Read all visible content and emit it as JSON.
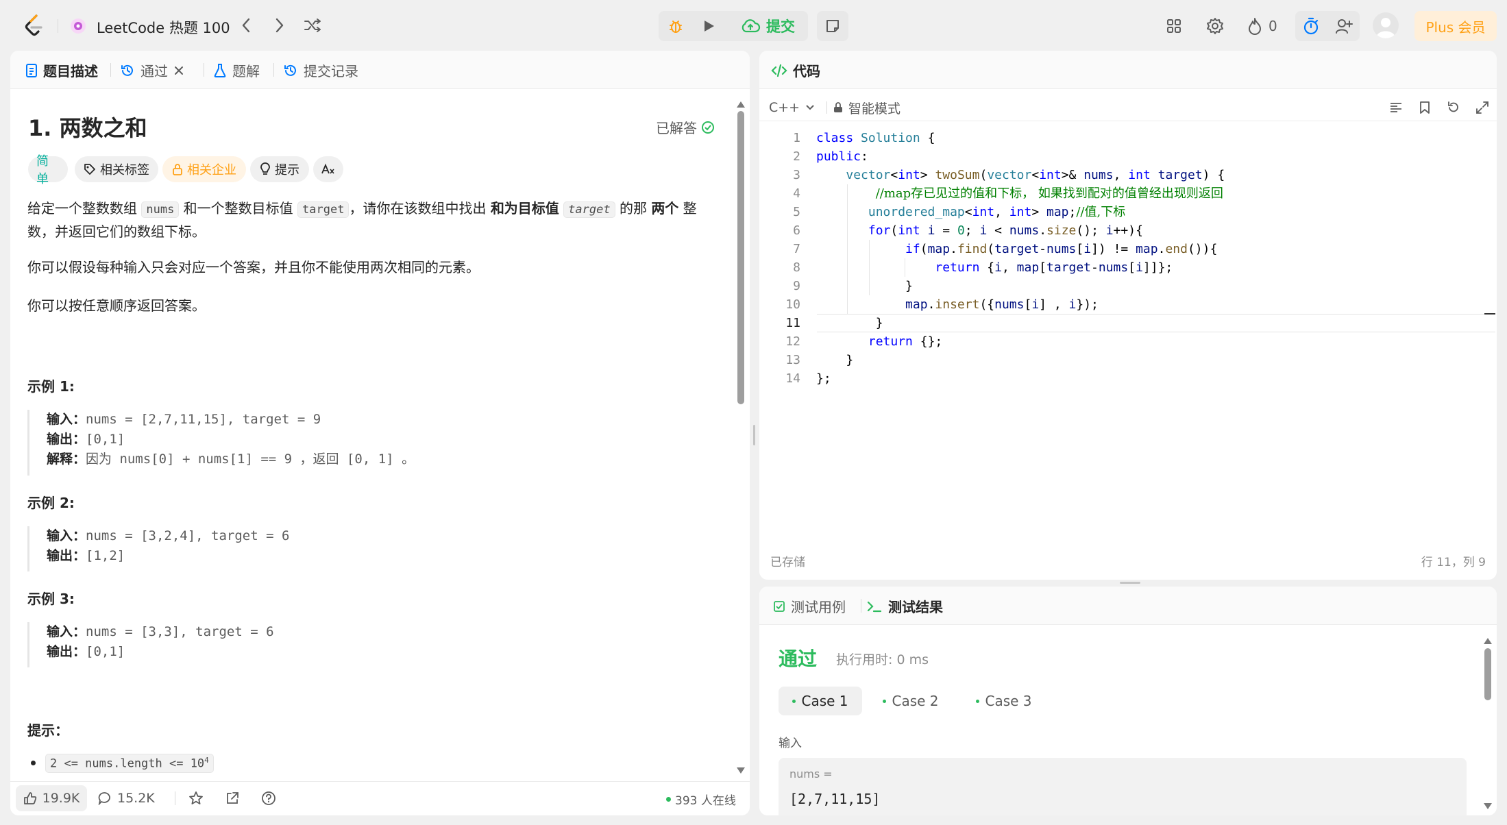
{
  "header": {
    "problem_list_title": "LeetCode 热题 100",
    "submit_label": "提交",
    "streak_count": "0",
    "plus_label": "Plus 会员"
  },
  "left_tabs": [
    {
      "label": "题目描述"
    },
    {
      "label": "通过"
    },
    {
      "label": "题解"
    },
    {
      "label": "提交记录"
    }
  ],
  "problem": {
    "title": "1. 两数之和",
    "solved_label": "已解答",
    "tags": {
      "difficulty": "简单",
      "related_tags": "相关标签",
      "related_companies": "相关企业",
      "hint": "提示"
    },
    "desc_p1": {
      "a": "给定一个整数数组 ",
      "nums": "nums",
      "b": " 和一个整数目标值 ",
      "target": "target",
      "c": "，请你在该数组中找出 ",
      "bold1": "和为目标值",
      "target2": "target",
      "d": " 的那 ",
      "bold2": "两个",
      "e": " 整数，并返回它们的数组下标。"
    },
    "desc_p2": "你可以假设每种输入只会对应一个答案，并且你不能使用两次相同的元素。",
    "desc_p3": "你可以按任意顺序返回答案。",
    "examples": [
      {
        "heading": "示例 1:",
        "input_label": "输入：",
        "input": "nums = [2,7,11,15], target = 9",
        "output_label": "输出：",
        "output": "[0,1]",
        "explain_label": "解释：",
        "explain": "因为 nums[0] + nums[1] == 9 ，返回 [0, 1] 。"
      },
      {
        "heading": "示例 2:",
        "input_label": "输入：",
        "input": "nums = [3,2,4], target = 6",
        "output_label": "输出：",
        "output": "[1,2]"
      },
      {
        "heading": "示例 3:",
        "input_label": "输入：",
        "input": "nums = [3,3], target = 6",
        "output_label": "输出：",
        "output": "[0,1]"
      }
    ],
    "constraints_heading": "提示：",
    "constraint_1": "2 <= nums.length <= 10",
    "constraint_1_sup": "4"
  },
  "footer": {
    "likes": "19.9K",
    "comments": "15.2K",
    "online": "393 人在线"
  },
  "editor": {
    "tab_label": "代码",
    "language": "C++",
    "mode": "智能模式",
    "saved": "已存储",
    "cursor": "行 11，列 9",
    "line_numbers": [
      "1",
      "2",
      "3",
      "4",
      "5",
      "6",
      "7",
      "8",
      "9",
      "10",
      "11",
      "12",
      "13",
      "14"
    ],
    "lines": [
      "class Solution {",
      "public:",
      "    vector<int> twoSum(vector<int>& nums, int target) {",
      "        //map存已见过的值和下标， 如果找到配对的值曾经出现则返回",
      "       unordered_map<int, int> map;//值,下标",
      "       for(int i = 0; i < nums.size(); i++){",
      "            if(map.find(target-nums[i]) != map.end()){",
      "                return {i, map[target-nums[i]]};",
      "            }",
      "            map.insert({nums[i] , i});",
      "        }",
      "       return {};",
      "    }",
      "};"
    ]
  },
  "result": {
    "tab_testcase": "测试用例",
    "tab_result": "测试结果",
    "status": "通过",
    "runtime": "执行用时: 0 ms",
    "cases": [
      "Case 1",
      "Case 2",
      "Case 3"
    ],
    "input_label": "输入",
    "var_name": "nums =",
    "var_value": "[2,7,11,15]"
  },
  "colors": {
    "accent_blue": "#007aff",
    "success_green": "#2cbb5d",
    "easy_teal": "#00af9b",
    "plus_orange": "#ffa116"
  }
}
